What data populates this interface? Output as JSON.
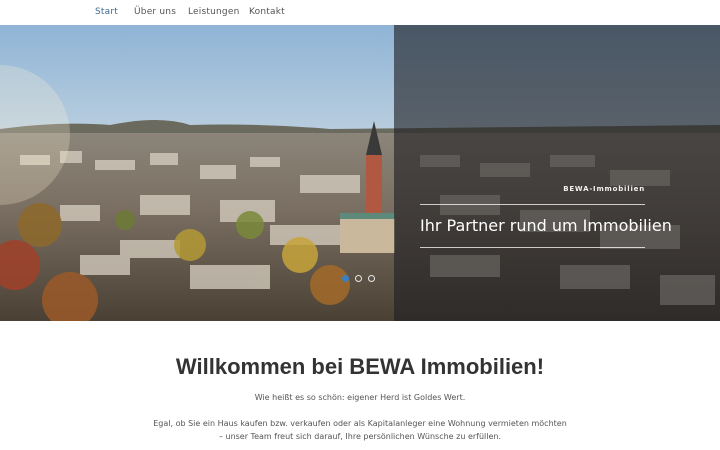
{
  "nav": {
    "items": [
      {
        "label": "Start",
        "active": true
      },
      {
        "label": "Über uns",
        "active": false
      },
      {
        "label": "Leistungen",
        "active": false
      },
      {
        "label": "Kontakt",
        "active": false
      }
    ]
  },
  "hero": {
    "eyebrow": "BEWA-Immobilien",
    "headline": "Ihr Partner rund um Immobilien",
    "image_description": "aerial-city-view-autumn",
    "slides_total": 3,
    "active_slide": 1
  },
  "main": {
    "welcome_title": "Willkommen bei BEWA Immobilien!",
    "tagline": "Wie heißt es so schön: eigener Herd ist Goldes Wert.",
    "intro_line_1": "Egal, ob Sie ein Haus kaufen bzw. verkaufen oder als Kapitalanleger eine Wohnung vermieten möchten",
    "intro_line_2": "– unser Team freut sich darauf, Ihre persönlichen Wünsche zu erfüllen."
  },
  "colors": {
    "nav_active": "#3b6a93",
    "dot_active": "#3a7fc4",
    "overlay": "#1e1e22"
  }
}
